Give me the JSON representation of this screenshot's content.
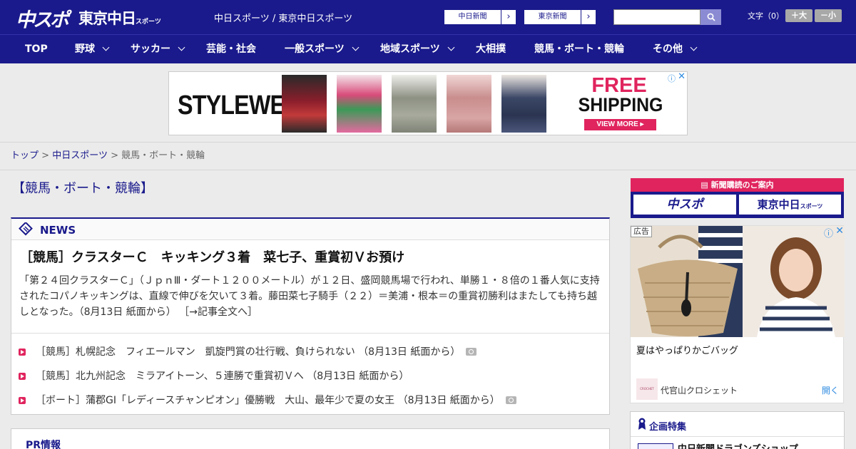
{
  "header": {
    "logo_chuspo": "中スポ",
    "logo_tokyo": "東京中日",
    "logo_tokyo_sub": "スポーツ",
    "tagline": "中日スポーツ / 東京中日スポーツ",
    "site_buttons": [
      {
        "label": "中日新聞",
        "arrow": "›"
      },
      {
        "label": "東京新聞",
        "arrow": "›"
      }
    ],
    "search": {
      "placeholder": ""
    },
    "font_size_label": "文字（0）",
    "font_larger": "＋大",
    "font_smaller": "－小"
  },
  "nav": {
    "items": [
      {
        "label": "TOP"
      },
      {
        "label": "野球"
      },
      {
        "label": "サッカー"
      },
      {
        "label": "芸能・社会"
      },
      {
        "label": "一般スポーツ"
      },
      {
        "label": "地域スポーツ"
      },
      {
        "label": "大相撲"
      },
      {
        "label": "競馬・ボート・競輪"
      },
      {
        "label": "その他"
      }
    ]
  },
  "ad_banner": {
    "brand": "STYLEWE",
    "headline1": "FREE",
    "headline2": "SHIPPING",
    "cta": "VIEW MORE ▸",
    "info": "ⓘ",
    "close": "✕"
  },
  "breadcrumb": {
    "home": "トップ",
    "sep": ">",
    "level1": "中日スポーツ",
    "current": "競馬・ボート・競輪"
  },
  "page_title": "【競馬・ボート・競輪】",
  "news": {
    "heading": "NEWS",
    "lead_title": "［競馬］クラスターＣ　キッキング３着　菜七子、重賞初Ｖお預け",
    "lead_body": "「第２４回クラスターＣ」（ＪｐｎⅢ・ダート１２００メートル）が１２日、盛岡競馬場で行われ、単勝１・８倍の１番人気に支持されたコパノキッキングは、直線で伸びを欠いて３着。藤田菜七子騎手（２２）＝美浦・根本＝の重賞初勝利はまたしても持ち越しとなった。（8月13日 紙面から）",
    "lead_more": "［→記事全文へ］",
    "items": [
      {
        "text": "［競馬］札幌記念　フィエールマン　凱旋門賞の壮行戦、負けられない （8月13日 紙面から）",
        "has_photo": true
      },
      {
        "text": "［競馬］北九州記念　ミラアイトーン、５連勝で重賞初Ｖへ （8月13日 紙面から）",
        "has_photo": false
      },
      {
        "text": "［ボート］蒲郡GI「レディースチャンピオン」優勝戦　大山、最年少で夏の女王 （8月13日 紙面から）",
        "has_photo": true
      }
    ]
  },
  "pr": {
    "heading": "PR情報"
  },
  "sidebar": {
    "subscribe_heading": "新聞購読のご案内",
    "subscribe_logo1": "中スポ",
    "subscribe_logo2": "東京中日",
    "subscribe_logo2_sub": "スポーツ",
    "ad_tag": "広告",
    "ad_text": "夏はやっぱりかごバッグ",
    "ad_advertiser": "代官山クロシェット",
    "ad_open": "開く",
    "ad_logo_text": "CROCHET",
    "feature_heading": "企画特集",
    "feature_item": "中日新聞ドラゴンズショップ"
  },
  "colors": {
    "brand_navy": "#1a1a8c",
    "accent_pink": "#e0245e",
    "link_blue": "#2e8be0"
  }
}
